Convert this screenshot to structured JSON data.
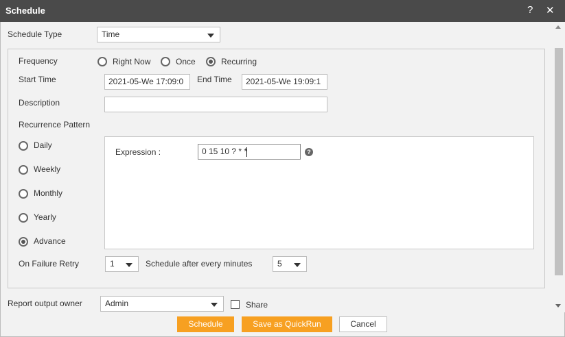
{
  "window": {
    "title": "Schedule",
    "help_glyph": "?",
    "close_glyph": "✕"
  },
  "schedule_type": {
    "label": "Schedule Type",
    "value": "Time"
  },
  "frequency": {
    "label": "Frequency",
    "options": [
      "Right Now",
      "Once",
      "Recurring"
    ],
    "selected": "Recurring"
  },
  "start_time": {
    "label": "Start Time",
    "value": "2021-05-We 17:09:0"
  },
  "end_time": {
    "label": "End Time",
    "value": "2021-05-We 19:09:1"
  },
  "description": {
    "label": "Description",
    "value": ""
  },
  "recurrence": {
    "label": "Recurrence Pattern",
    "options": [
      "Daily",
      "Weekly",
      "Monthly",
      "Yearly",
      "Advance"
    ],
    "selected": "Advance",
    "expression_label": "Expression :",
    "expression_value": "0 15 10 ? * *",
    "help_glyph": "?"
  },
  "retry": {
    "label": "On Failure Retry",
    "value": "1",
    "interval_label": "Schedule after every minutes",
    "interval_value": "5"
  },
  "owner": {
    "label": "Report output owner",
    "value": "Admin"
  },
  "share": {
    "label": "Share",
    "checked": false
  },
  "buttons": {
    "schedule": "Schedule",
    "save_quickrun": "Save as QuickRun",
    "cancel": "Cancel"
  }
}
